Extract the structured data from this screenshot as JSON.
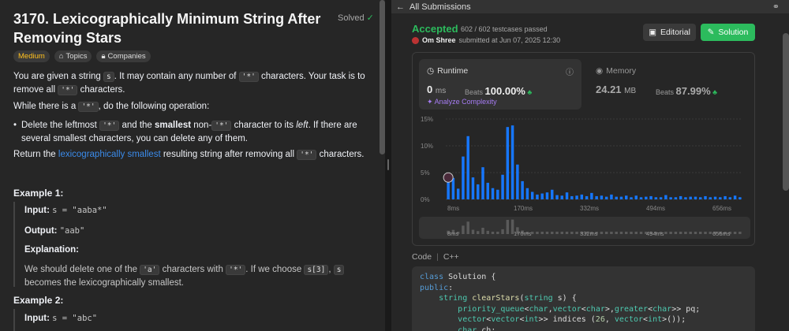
{
  "problem": {
    "title": "3170. Lexicographically Minimum String After Removing Stars",
    "solved_label": "Solved",
    "tags": [
      "Medium",
      "Topics",
      "Companies"
    ],
    "desc_1a": "You are given a string ",
    "desc_1_code": "s",
    "desc_1b": ". It may contain any number of ",
    "star_code": "'*'",
    "desc_1c": " characters. Your task is to remove all ",
    "desc_1d": " characters.",
    "desc_2a": "While there is a ",
    "desc_2b": ", do the following operation:",
    "bullet_a": "Delete the leftmost ",
    "bullet_b": " and the ",
    "bullet_bold": "smallest",
    "bullet_c": " non-",
    "bullet_d": " character to its ",
    "bullet_em": "left",
    "bullet_e": ". If there are several smallest characters, you can delete any of them.",
    "desc_3a": "Return the ",
    "desc_3_link": "lexicographically smallest",
    "desc_3b": " resulting string after removing all ",
    "desc_3c": " characters.",
    "example1_head": "Example 1:",
    "input_label": "Input:",
    "ex1_input": "s = \"aaba*\"",
    "output_label": "Output:",
    "ex1_output": "\"aab\"",
    "explanation_label": "Explanation:",
    "ex1_expl_a": "We should delete one of the ",
    "ex1_expl_code_a": "'a'",
    "ex1_expl_b": " characters with ",
    "ex1_expl_c": ". If we choose ",
    "ex1_expl_code_s3": "s[3]",
    "ex1_expl_d": ", ",
    "ex1_expl_e": " becomes the lexicographically smallest.",
    "example2_head": "Example 2:",
    "ex2_input": "s = \"abc\""
  },
  "submission": {
    "header_title": "All Submissions",
    "status": "Accepted",
    "tests": "602 / 602 testcases passed",
    "author": "Om Shree",
    "submitted": "submitted at Jun 07, 2025 12:30",
    "editorial_label": "Editorial",
    "solution_label": "Solution",
    "runtime_label": "Runtime",
    "runtime_value": "0",
    "runtime_unit": "ms",
    "beats_label": "Beats",
    "runtime_beats": "100.00%",
    "analyze_label": "Analyze Complexity",
    "memory_label": "Memory",
    "memory_value": "24.21",
    "memory_unit": "MB",
    "memory_beats": "87.99%",
    "code_label": "Code",
    "language": "C++",
    "colors": {
      "accent_green": "#2cbb5d",
      "bar_blue": "#1677ff"
    }
  },
  "code_lines": [
    "class Solution {",
    "public:",
    "    string clearStars(string s) {",
    "        priority_queue<char,vector<char>,greater<char>> pq;",
    "        vector<vector<int>> indices (26, vector<int>());",
    "        char ch;"
  ],
  "chart_data": {
    "type": "bar",
    "title": "",
    "xlabel": "",
    "ylabel": "",
    "x_tick_labels": [
      "8ms",
      "170ms",
      "332ms",
      "494ms",
      "656ms"
    ],
    "y_tick_labels": [
      "0%",
      "5%",
      "10%",
      "15%"
    ],
    "ylim": [
      0,
      15
    ],
    "values": [
      3.2,
      4,
      2,
      8,
      11.8,
      4.1,
      2.8,
      6,
      3.1,
      2.1,
      1.8,
      4.6,
      13.5,
      13.8,
      6.5,
      3.4,
      2.1,
      1.4,
      0.9,
      1.1,
      1.3,
      1.8,
      0.8,
      0.7,
      1.3,
      0.6,
      0.7,
      0.9,
      0.6,
      1.2,
      0.6,
      0.7,
      0.5,
      0.9,
      0.5,
      0.5,
      0.7,
      0.4,
      0.7,
      0.4,
      0.5,
      0.6,
      0.4,
      0.4,
      0.8,
      0.4,
      0.4,
      0.6,
      0.4,
      0.5,
      0.5,
      0.4,
      0.6,
      0.4,
      0.5,
      0.4,
      0.6,
      0.4,
      0.7,
      0.4
    ],
    "highlight_index": 0,
    "grid": true
  }
}
